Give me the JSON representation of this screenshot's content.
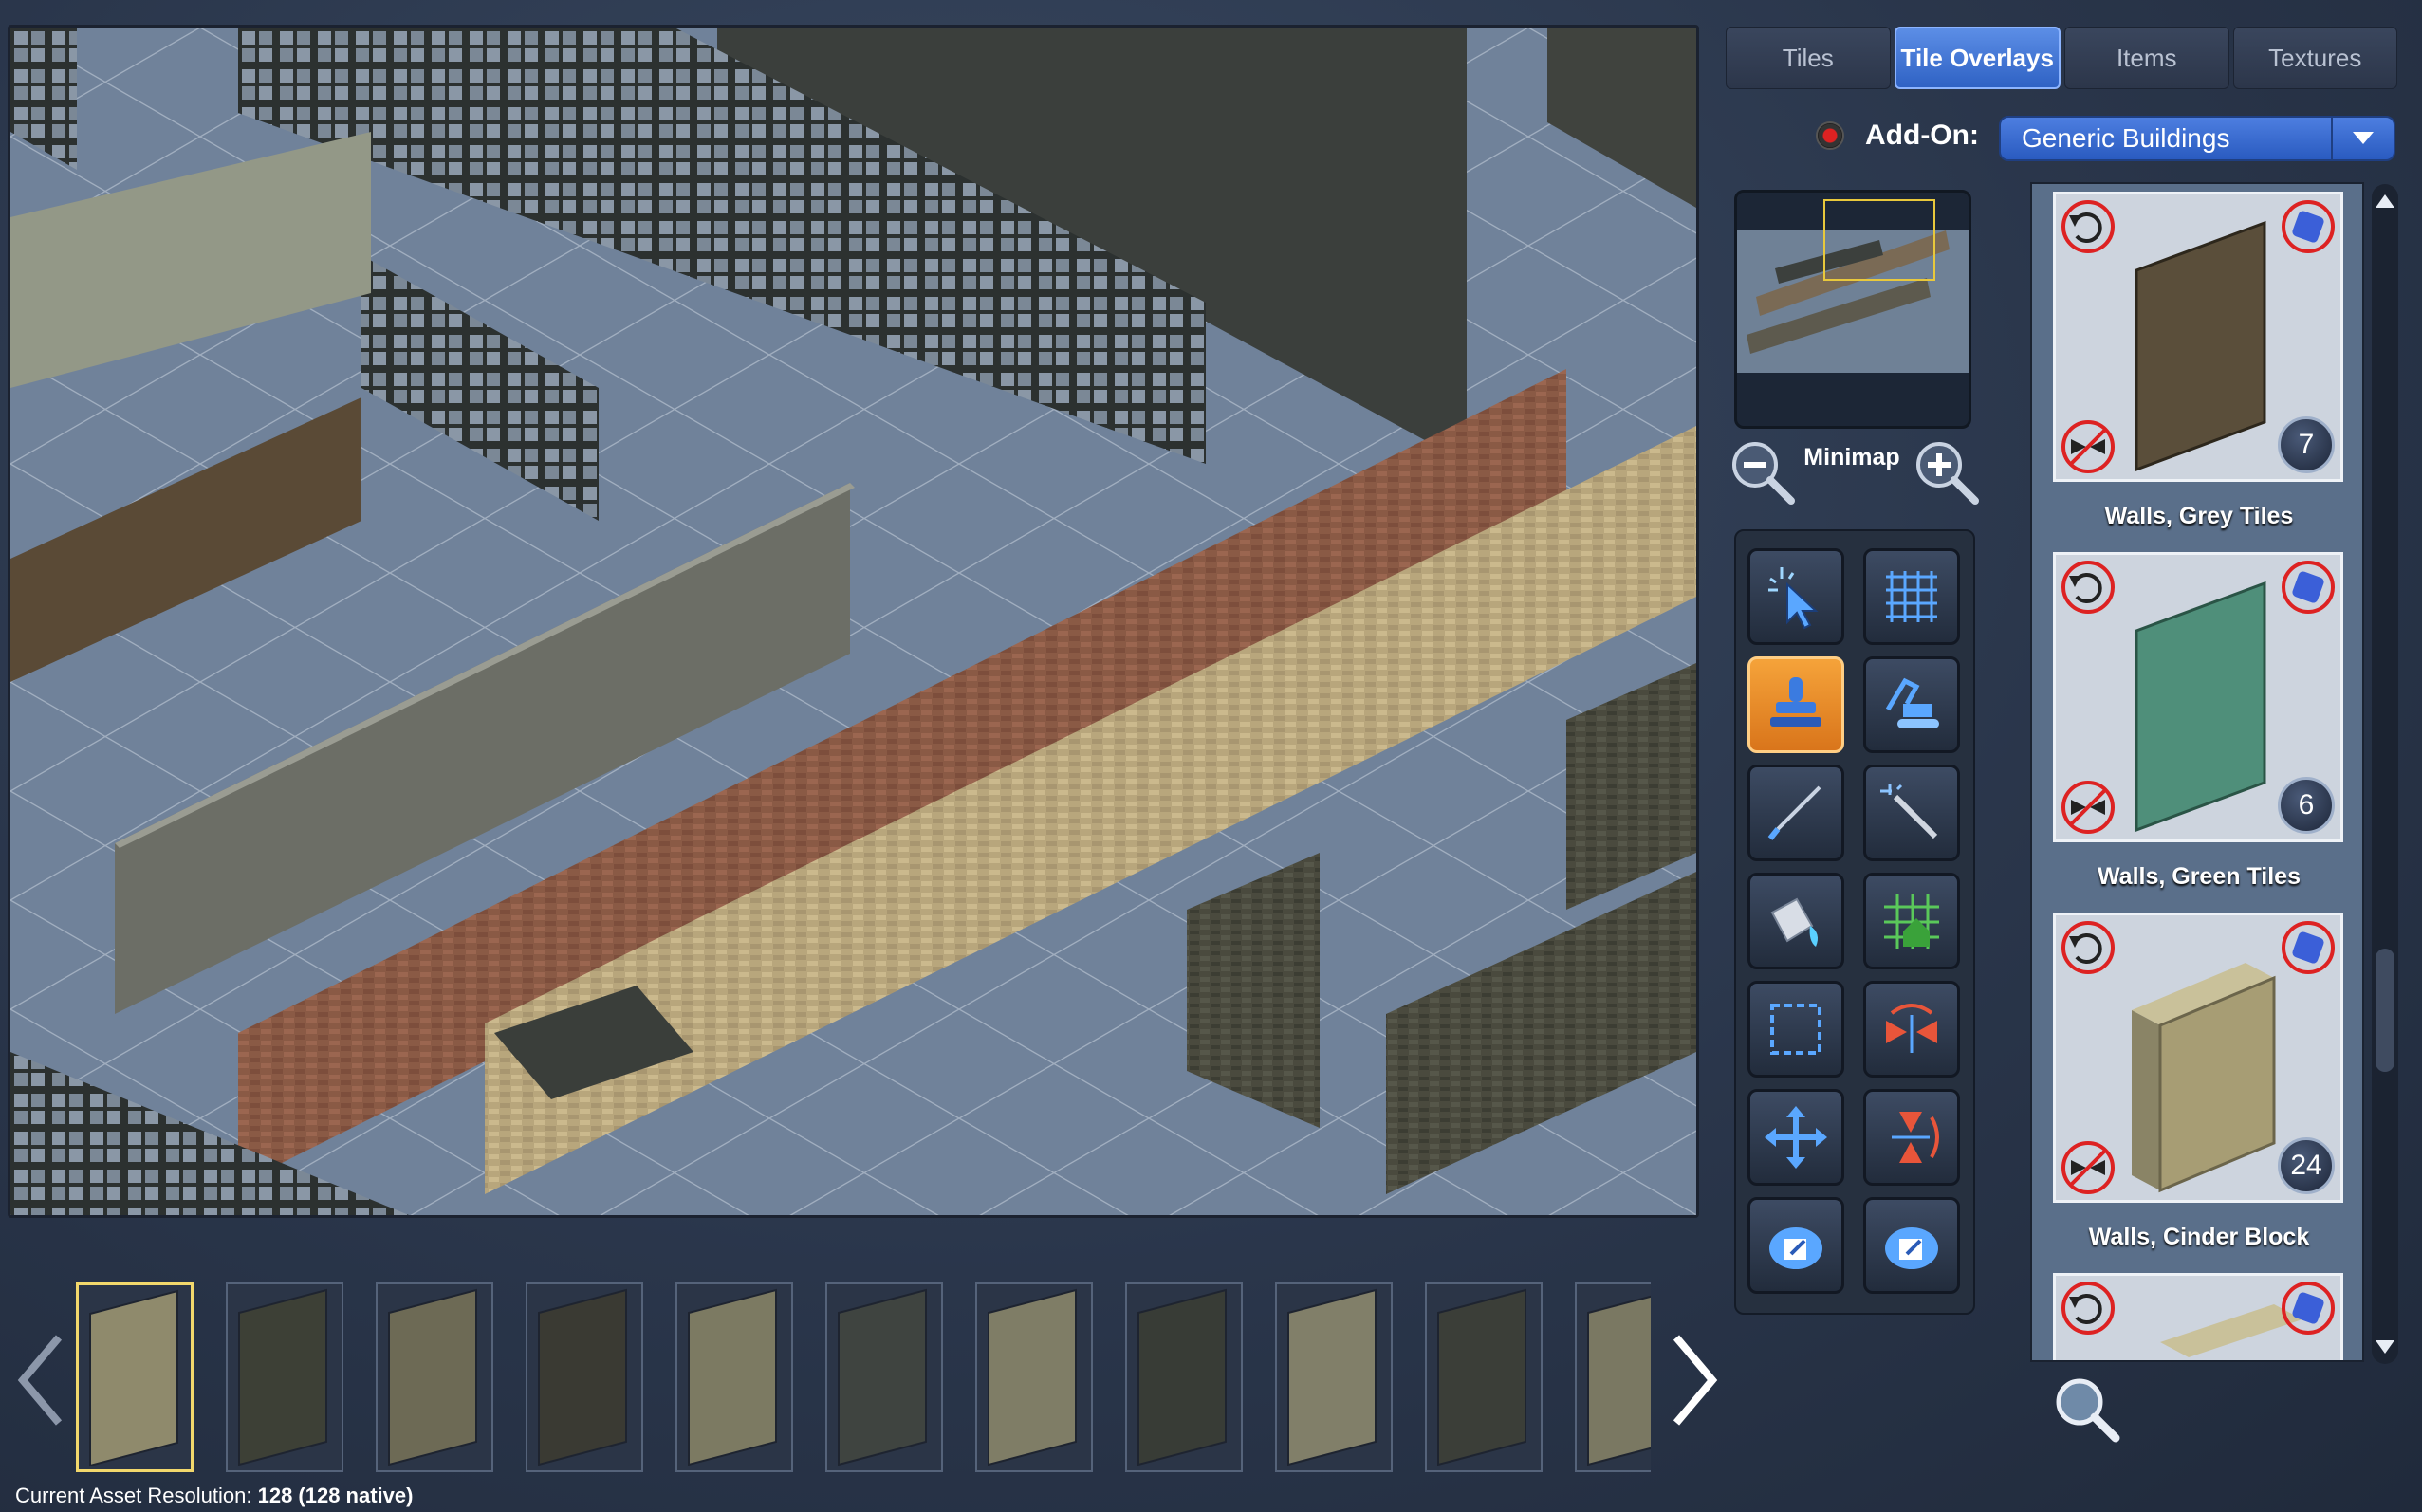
{
  "tabs": [
    {
      "label": "Tiles",
      "active": false
    },
    {
      "label": "Tile Overlays",
      "active": true
    },
    {
      "label": "Items",
      "active": false
    },
    {
      "label": "Textures",
      "active": false
    }
  ],
  "addon": {
    "label": "Add-On:",
    "value": "Generic Buildings"
  },
  "minimap": {
    "label": "Minimap"
  },
  "tools": [
    {
      "name": "select-tool",
      "icon": "pointer-sparkle-icon",
      "active": false
    },
    {
      "name": "grid-tool",
      "icon": "grid-icon",
      "active": false
    },
    {
      "name": "stamp-tool",
      "icon": "stamp-icon",
      "active": true
    },
    {
      "name": "bulldozer-tool",
      "icon": "excavator-icon",
      "active": false
    },
    {
      "name": "brush-tool",
      "icon": "brush-icon",
      "active": false
    },
    {
      "name": "magic-wand-tool",
      "icon": "magic-wand-icon",
      "active": false
    },
    {
      "name": "fill-tool",
      "icon": "paint-bucket-icon",
      "active": false
    },
    {
      "name": "grid-house-tool",
      "icon": "grid-house-icon",
      "active": false
    },
    {
      "name": "marquee-tool",
      "icon": "marquee-icon",
      "active": false
    },
    {
      "name": "flip-horizontal-tool",
      "icon": "flip-horizontal-icon",
      "active": false
    },
    {
      "name": "move-tool",
      "icon": "move-arrows-icon",
      "active": false
    },
    {
      "name": "flip-vertical-tool",
      "icon": "flip-vertical-icon",
      "active": false
    },
    {
      "name": "import-tool",
      "icon": "cloud-import-icon",
      "active": false
    },
    {
      "name": "export-tool",
      "icon": "cloud-export-icon",
      "active": false
    }
  ],
  "assets": [
    {
      "name": "Walls, Grey Tiles",
      "count": "7",
      "color": "#5a4e3a"
    },
    {
      "name": "Walls, Green Tiles",
      "count": "6",
      "color": "#4f8f7a"
    },
    {
      "name": "Walls, Cinder Block",
      "count": "24",
      "color": "#a79d74"
    },
    {
      "name": "",
      "count": "",
      "color": "#c9c19a"
    }
  ],
  "thumbnails": [
    {
      "color": "#8f8a6c",
      "selected": true
    },
    {
      "color": "#3d4036",
      "selected": false
    },
    {
      "color": "#6d6a55",
      "selected": false
    },
    {
      "color": "#3a3a33",
      "selected": false
    },
    {
      "color": "#7c7a62",
      "selected": false
    },
    {
      "color": "#3f4440",
      "selected": false
    },
    {
      "color": "#7f7d66",
      "selected": false
    },
    {
      "color": "#383c36",
      "selected": false
    },
    {
      "color": "#817f69",
      "selected": false
    },
    {
      "color": "#3b3e38",
      "selected": false
    },
    {
      "color": "#7a7862",
      "selected": false
    }
  ],
  "status": {
    "label": "Current Asset Resolution:",
    "value": "128 (128 native)"
  }
}
